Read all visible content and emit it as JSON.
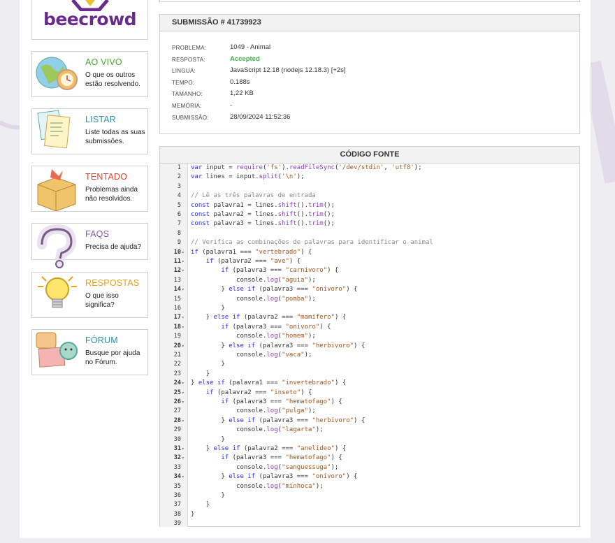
{
  "brand": {
    "name": "beecrowd",
    "color": "#6a2c8c"
  },
  "sidebar": {
    "items": [
      {
        "title": "AO VIVO",
        "desc": "O que os outros estão resolvendo.",
        "color": "#4aa62f",
        "icon": "globe-clock-icon"
      },
      {
        "title": "LISTAR",
        "desc": "Liste todas as suas submissões.",
        "color": "#2a91a8",
        "icon": "documents-icon"
      },
      {
        "title": "TENTADO",
        "desc": "Problemas ainda não resolvidos.",
        "color": "#d9452b",
        "icon": "box-icon"
      },
      {
        "title": "FAQS",
        "desc": "Precisa de ajuda?",
        "color": "#8a5aa8",
        "icon": "question-mark-icon"
      },
      {
        "title": "RESPOSTAS",
        "desc": "O que isso significa?",
        "color": "#e6a316",
        "icon": "lightbulb-icon"
      },
      {
        "title": "FÓRUM",
        "desc": "Busque por ajuda no Fórum.",
        "color": "#2a91a8",
        "icon": "forum-chat-icon"
      }
    ]
  },
  "submission": {
    "header": "SUBMISSÃO # 41739923",
    "rows": [
      {
        "label": "PROBLEMA:",
        "value": "1049 - Animal"
      },
      {
        "label": "RESPOSTA:",
        "value": "Accepted"
      },
      {
        "label": "LINGUA:",
        "value": "JavaScript 12.18 (nodejs 12.18.3) [+2s]"
      },
      {
        "label": "TEMPO:",
        "value": "0.188s"
      },
      {
        "label": "TAMANHO:",
        "value": "1,22 KB"
      },
      {
        "label": "MEMÓRIA:",
        "value": "-"
      },
      {
        "label": "SUBMISSÃO:",
        "value": "28/09/2024 11:52:36"
      }
    ]
  },
  "code": {
    "header": "CÓDIGO FONTE",
    "lines": [
      "var input = require('fs').readFileSync('/dev/stdin', 'utf8');",
      "var lines = input.split('\\n');",
      "",
      "// Lê as três palavras de entrada",
      "const palavra1 = lines.shift().trim();",
      "const palavra2 = lines.shift().trim();",
      "const palavra3 = lines.shift().trim();",
      "",
      "// Verifica as combinações de palavras para identificar o animal",
      "if (palavra1 === \"vertebrado\") {",
      "    if (palavra2 === \"ave\") {",
      "        if (palavra3 === \"carnivoro\") {",
      "            console.log(\"aguia\");",
      "        } else if (palavra3 === \"onivoro\") {",
      "            console.log(\"pomba\");",
      "        }",
      "    } else if (palavra2 === \"mamifero\") {",
      "        if (palavra3 === \"onivoro\") {",
      "            console.log(\"homem\");",
      "        } else if (palavra3 === \"herbivoro\") {",
      "            console.log(\"vaca\");",
      "        }",
      "    }",
      "} else if (palavra1 === \"invertebrado\") {",
      "    if (palavra2 === \"inseto\") {",
      "        if (palavra3 === \"hematofago\") {",
      "            console.log(\"pulga\");",
      "        } else if (palavra3 === \"herbivoro\") {",
      "            console.log(\"lagarta\");",
      "        }",
      "    } else if (palavra2 === \"anelideo\") {",
      "        if (palavra3 === \"hematofago\") {",
      "            console.log(\"sanguessuga\");",
      "        } else if (palavra3 === \"onivoro\") {",
      "            console.log(\"minhoca\");",
      "        }",
      "    }",
      "}",
      ""
    ],
    "fold_lines": [
      10,
      11,
      12,
      14,
      17,
      18,
      20,
      24,
      25,
      26,
      28,
      31,
      32,
      34
    ]
  },
  "colors": {
    "accepted": "#3bb34a",
    "keyword": "#2b2bff",
    "string": "#a3551a",
    "comment": "#8a8a8a",
    "method": "#8a3dbf"
  }
}
